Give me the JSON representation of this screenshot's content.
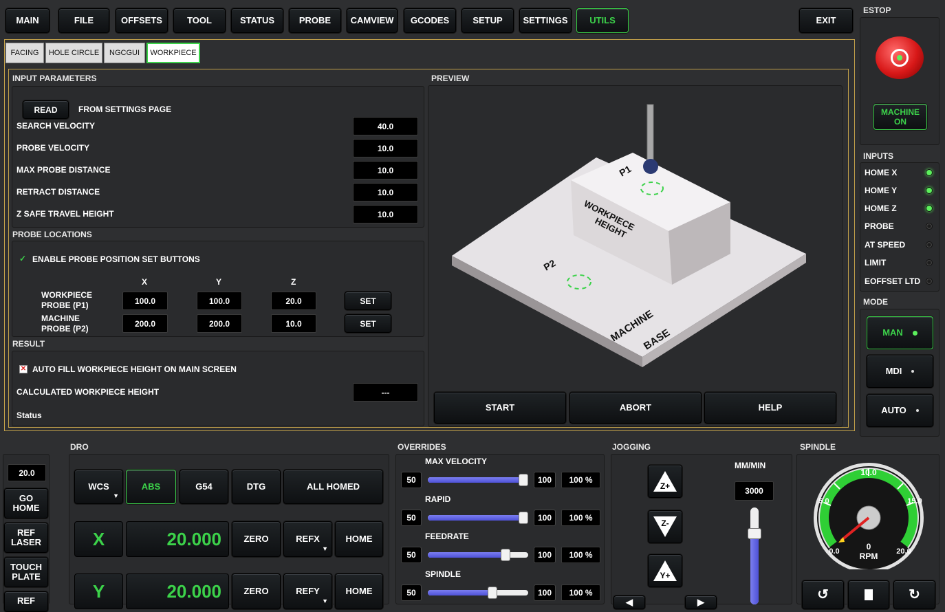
{
  "nav": {
    "main": "MAIN",
    "file": "FILE",
    "offsets": "OFFSETS",
    "tool": "TOOL",
    "status": "STATUS",
    "probe": "PROBE",
    "camview": "CAMVIEW",
    "gcodes": "GCODES",
    "setup": "SETUP",
    "settings": "SETTINGS",
    "utils": "UTILS",
    "exit": "EXIT"
  },
  "subtabs": {
    "facing": "FACING",
    "hole_circle": "HOLE CIRCLE",
    "ngcgui": "NGCGUI",
    "workpiece": "WORKPIECE"
  },
  "input_params": {
    "title": "INPUT PARAMETERS",
    "read": "READ",
    "from_settings": "FROM SETTINGS PAGE",
    "rows": [
      {
        "label": "SEARCH VELOCITY",
        "value": "40.0"
      },
      {
        "label": "PROBE VELOCITY",
        "value": "10.0"
      },
      {
        "label": "MAX PROBE DISTANCE",
        "value": "10.0"
      },
      {
        "label": "RETRACT DISTANCE",
        "value": "10.0"
      },
      {
        "label": "Z SAFE TRAVEL HEIGHT",
        "value": "10.0"
      }
    ]
  },
  "probe_locations": {
    "title": "PROBE LOCATIONS",
    "enable_label": "ENABLE PROBE POSITION SET BUTTONS",
    "check": "✓",
    "col_x": "X",
    "col_y": "Y",
    "col_z": "Z",
    "p1": {
      "label1": "WORKPIECE",
      "label2": "PROBE (P1)",
      "x": "100.0",
      "y": "100.0",
      "z": "20.0",
      "set": "SET"
    },
    "p2": {
      "label1": "MACHINE",
      "label2": "PROBE (P2)",
      "x": "200.0",
      "y": "200.0",
      "z": "10.0",
      "set": "SET"
    }
  },
  "result": {
    "title": "RESULT",
    "autofill_label": "AUTO FILL WORKPIECE HEIGHT ON MAIN SCREEN",
    "calc_label": "CALCULATED WORKPIECE HEIGHT",
    "calc_value": "---",
    "status": "Status"
  },
  "preview": {
    "title": "PREVIEW",
    "p1": "P1",
    "p2": "P2",
    "wp_line1": "WORKPIECE",
    "wp_line2": "HEIGHT",
    "mb_line1": "MACHINE",
    "mb_line2": "BASE",
    "start": "START",
    "abort": "ABORT",
    "help": "HELP"
  },
  "estop": {
    "title": "ESTOP",
    "machine_on_1": "MACHINE",
    "machine_on_2": "ON"
  },
  "inputs": {
    "title": "INPUTS",
    "items": [
      {
        "label": "HOME X",
        "state": "on"
      },
      {
        "label": "HOME Y",
        "state": "on"
      },
      {
        "label": "HOME Z",
        "state": "on"
      },
      {
        "label": "PROBE",
        "state": "off"
      },
      {
        "label": "AT SPEED",
        "state": "off"
      },
      {
        "label": "LIMIT",
        "state": "off"
      },
      {
        "label": "EOFFSET LTD",
        "state": "off"
      }
    ]
  },
  "mode": {
    "title": "MODE",
    "man": "MAN",
    "mdi": "MDI",
    "auto": "AUTO"
  },
  "left_side": {
    "value": "20.0",
    "go_home_1": "GO",
    "go_home_2": "HOME",
    "ref_laser_1": "REF",
    "ref_laser_2": "LASER",
    "touch_plate_1": "TOUCH",
    "touch_plate_2": "PLATE",
    "ref": "REF"
  },
  "dro": {
    "title": "DRO",
    "wcs": "WCS",
    "abs": "ABS",
    "g54": "G54",
    "dtg": "DTG",
    "all_homed": "ALL HOMED",
    "x_axis": "X",
    "x_value": "20.000",
    "y_axis": "Y",
    "y_value": "20.000",
    "zero": "ZERO",
    "refx": "REFX",
    "refy": "REFY",
    "home": "HOME"
  },
  "overrides": {
    "title": "OVERRIDES",
    "items": [
      {
        "label": "MAX VELOCITY",
        "min": "50",
        "max": "100",
        "pct": "100 %",
        "level": 1.0
      },
      {
        "label": "RAPID",
        "min": "50",
        "max": "100",
        "pct": "100 %",
        "level": 1.0
      },
      {
        "label": "FEEDRATE",
        "min": "50",
        "max": "100",
        "pct": "100 %",
        "level": 0.8
      },
      {
        "label": "SPINDLE",
        "min": "50",
        "max": "100",
        "pct": "100 %",
        "level": 0.66
      }
    ]
  },
  "jogging": {
    "title": "JOGGING",
    "units": "MM/MIN",
    "rate": "3000",
    "zplus": "Z+",
    "zminus": "Z-",
    "yplus": "Y+"
  },
  "spindle": {
    "title": "SPINDLE",
    "t10": "10.0",
    "t5": "5.0",
    "t15": "15.0",
    "t0": "0.0",
    "t20": "20.0",
    "rpm_value": "0",
    "rpm_label": "RPM"
  },
  "colors": {
    "accent": "#3cd24a",
    "panel_border": "#c4a24a",
    "bg": "#2e2f31"
  }
}
